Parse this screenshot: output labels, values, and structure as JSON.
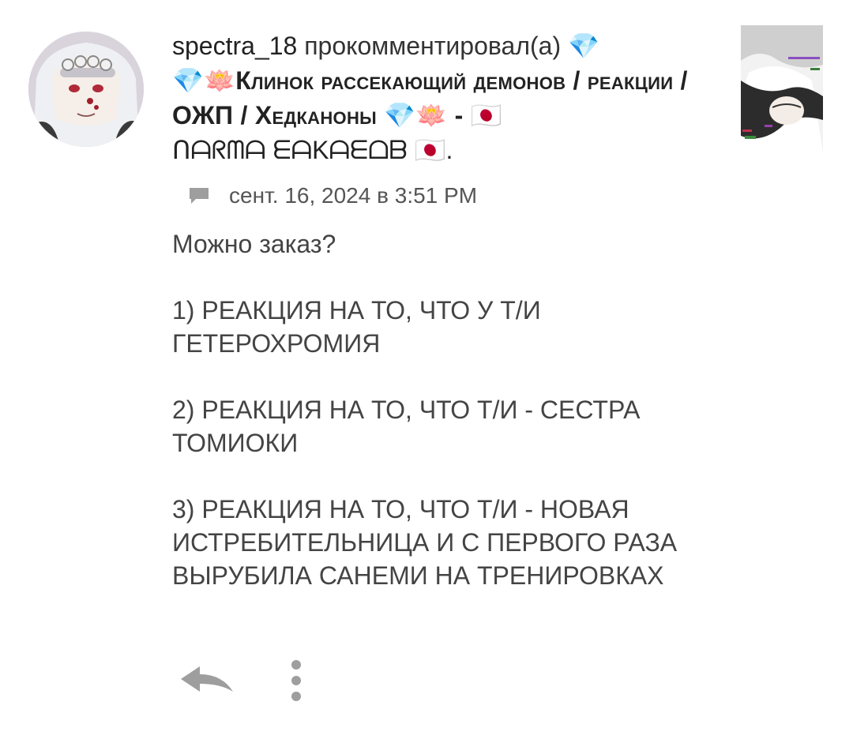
{
  "comment": {
    "username": "spectra_18",
    "action": "прокомментировал(а)",
    "story_title_line": "💎🪷Клинок рассекающий демонов / реакции / ОЖП / Хедканоны 💎🪷 - 🇯🇵",
    "story_subtitle": "ᑎᗩᖇᗰᗩ ᗴᗩKᗩᗴᗝᗷ 🇯🇵.",
    "timestamp": "сент. 16, 2024 в 3:51 PM",
    "body": {
      "line_intro": "Можно заказ?",
      "item1": "1) РЕАКЦИЯ НА ТО, ЧТО У Т/И ГЕТЕРОХРОМИЯ",
      "item2": "2) РЕАКЦИЯ НА ТО, ЧТО Т/И - СЕСТРА ТОМИОКИ",
      "item3": "3) РЕАКЦИЯ НА ТО, ЧТО Т/И - НОВАЯ ИСТРЕБИТЕЛЬНИЦА  И С ПЕРВОГО РАЗА ВЫРУБИЛА САНЕМИ НА ТРЕНИРОВКАХ"
    }
  },
  "icons": {
    "chat": "chat-bubble-icon",
    "reply": "reply-arrow-icon",
    "more": "more-vertical-icon"
  },
  "colors": {
    "text_primary": "#222222",
    "text_body": "#444444",
    "icon_gray": "#9e9e9e"
  }
}
